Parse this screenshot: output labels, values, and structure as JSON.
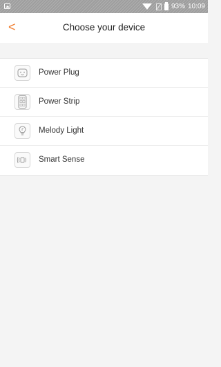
{
  "status_bar": {
    "battery": "93%",
    "time": "10:09",
    "icons": [
      "image-icon",
      "wifi-icon",
      "no-sim-icon",
      "battery-icon"
    ]
  },
  "header": {
    "back_glyph": "<",
    "title": "Choose your device"
  },
  "devices": [
    {
      "label": "Power Plug",
      "icon": "power-plug-icon"
    },
    {
      "label": "Power Strip",
      "icon": "power-strip-icon"
    },
    {
      "label": "Melody Light",
      "icon": "melody-light-icon"
    },
    {
      "label": "Smart Sense",
      "icon": "smart-sense-icon"
    }
  ],
  "colors": {
    "accent": "#f07a2a",
    "background": "#f4f4f4",
    "status_bar": "#9e9e9e"
  }
}
